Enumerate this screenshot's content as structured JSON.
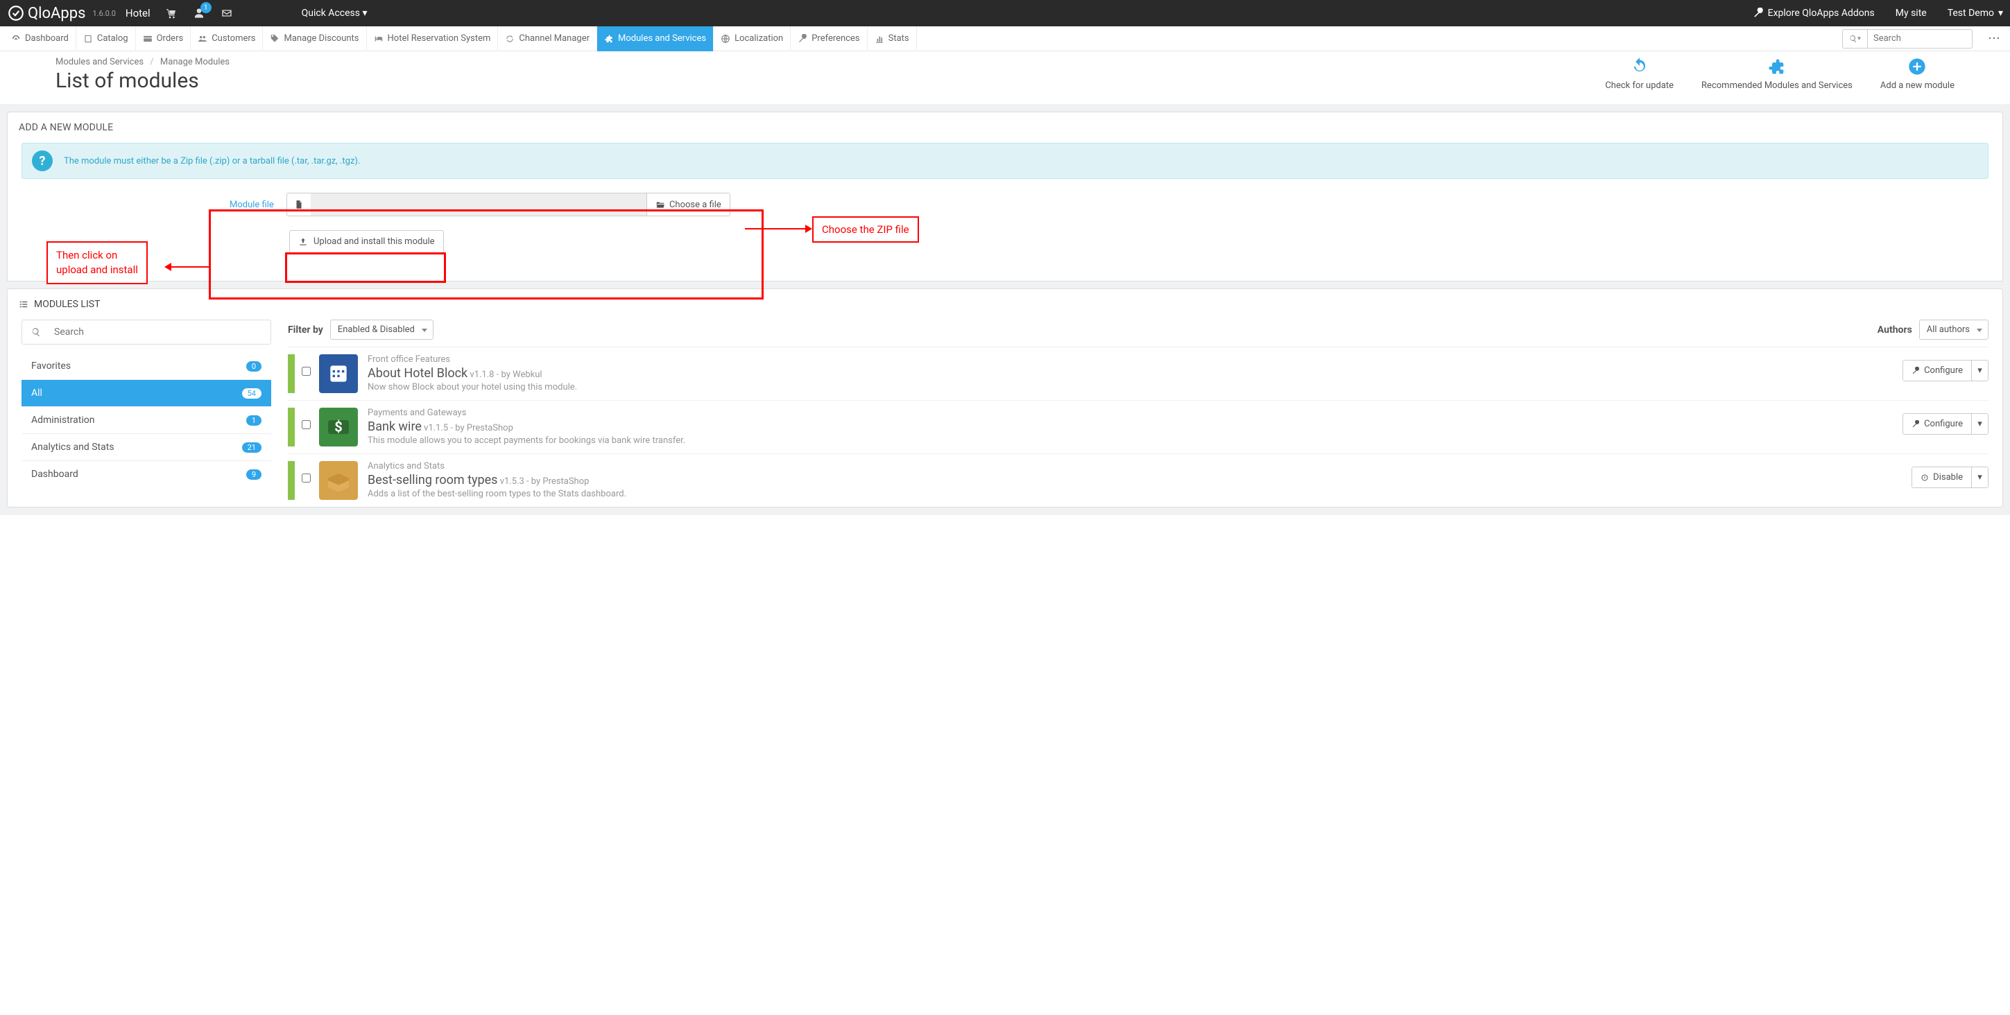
{
  "topbar": {
    "brand": "QloApps",
    "version": "1.6.0.0",
    "hotel": "Hotel",
    "notif": "1",
    "quick_access": "Quick Access",
    "explore": "Explore QloApps Addons",
    "my_site": "My site",
    "user": "Test Demo"
  },
  "nav": [
    "Dashboard",
    "Catalog",
    "Orders",
    "Customers",
    "Manage Discounts",
    "Hotel Reservation System",
    "Channel Manager",
    "Modules and Services",
    "Localization",
    "Preferences",
    "Stats"
  ],
  "search_placeholder": "Search",
  "breadcrumb": {
    "a": "Modules and Services",
    "b": "Manage Modules"
  },
  "page_title": "List of modules",
  "header_actions": {
    "check": "Check for update",
    "reco": "Recommended Modules and Services",
    "add": "Add a new module"
  },
  "panel": {
    "title": "ADD A NEW MODULE",
    "info": "The module must either be a Zip file (.zip) or a tarball file (.tar, .tar.gz, .tgz).",
    "module_file": "Module file",
    "choose": "Choose a file",
    "upload": "Upload and install this module"
  },
  "callouts": {
    "right": "Choose the ZIP file",
    "left1": "Then click on",
    "left2": "upload and install"
  },
  "list": {
    "title": "MODULES LIST",
    "search_placeholder": "Search",
    "filter_by": "Filter by",
    "filter_value": "Enabled & Disabled",
    "authors": "Authors",
    "authors_value": "All authors",
    "cats": [
      {
        "name": "Favorites",
        "count": "0"
      },
      {
        "name": "All",
        "count": "54"
      },
      {
        "name": "Administration",
        "count": "1"
      },
      {
        "name": "Analytics and Stats",
        "count": "21"
      },
      {
        "name": "Dashboard",
        "count": "9"
      }
    ],
    "configure": "Configure",
    "disable": "Disable",
    "mods": [
      {
        "cat": "Front office Features",
        "name": "About Hotel Block",
        "ver": "v1.1.8",
        "by": "by Webkul",
        "desc": "Now show Block about your hotel using this module.",
        "color": "#2c5aa0",
        "glyph": "calendar",
        "action": "Configure"
      },
      {
        "cat": "Payments and Gateways",
        "name": "Bank wire",
        "ver": "v1.1.5",
        "by": "by PrestaShop",
        "desc": "This module allows you to accept payments for bookings via bank wire transfer.",
        "color": "#3e8e41",
        "glyph": "dollar",
        "action": "Configure"
      },
      {
        "cat": "Analytics and Stats",
        "name": "Best-selling room types",
        "ver": "v1.5.3",
        "by": "by PrestaShop",
        "desc": "Adds a list of the best-selling room types to the Stats dashboard.",
        "color": "#d6a24a",
        "glyph": "box",
        "action": "Disable"
      }
    ]
  }
}
